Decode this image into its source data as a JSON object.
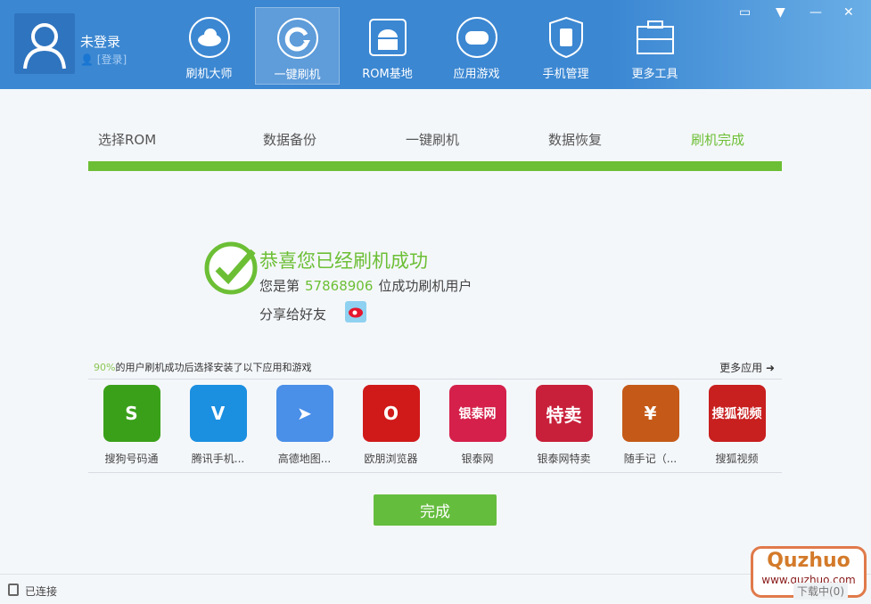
{
  "header": {
    "user_name": "未登录",
    "login_link": "[登录]",
    "nav": [
      {
        "label": "刷机大师",
        "icon": "cloud-icon"
      },
      {
        "label": "一键刷机",
        "icon": "refresh-icon"
      },
      {
        "label": "ROM基地",
        "icon": "android-icon"
      },
      {
        "label": "应用游戏",
        "icon": "gamepad-icon"
      },
      {
        "label": "手机管理",
        "icon": "phone-shield-icon"
      },
      {
        "label": "更多工具",
        "icon": "toolbox-icon"
      }
    ]
  },
  "steps": [
    "选择ROM",
    "数据备份",
    "一键刷机",
    "数据恢复",
    "刷机完成"
  ],
  "result": {
    "title": "恭喜您已经刷机成功",
    "prefix": "您是第",
    "count": "57868906",
    "suffix": "位成功刷机用户",
    "share": "分享给好友"
  },
  "recommend": {
    "percent": "90%",
    "text": "的用户刷机成功后选择安装了以下应用和游戏",
    "more": "更多应用 ➜",
    "apps": [
      {
        "name": "搜狗号码通",
        "glyph": "S",
        "color": "#3aa01a"
      },
      {
        "name": "腾讯手机...",
        "glyph": "V",
        "color": "#1b8fe0"
      },
      {
        "name": "高德地图...",
        "glyph": "➤",
        "color": "#4a8fe8"
      },
      {
        "name": "欧朋浏览器",
        "glyph": "O",
        "color": "#d01a1a"
      },
      {
        "name": "银泰网",
        "glyph": "银泰网",
        "color": "#d4204a"
      },
      {
        "name": "银泰网特卖",
        "glyph": "特卖",
        "color": "#c8203a"
      },
      {
        "name": "随手记（...",
        "glyph": "¥",
        "color": "#c55a18"
      },
      {
        "name": "搜狐视频",
        "glyph": "搜狐视频",
        "color": "#c81f1f"
      }
    ]
  },
  "done_label": "完成",
  "status": {
    "connected": "已连接",
    "downloading": "下载中(0)"
  },
  "watermark": {
    "brand": "Quzhuo",
    "url": "www.quzhuo.com"
  }
}
